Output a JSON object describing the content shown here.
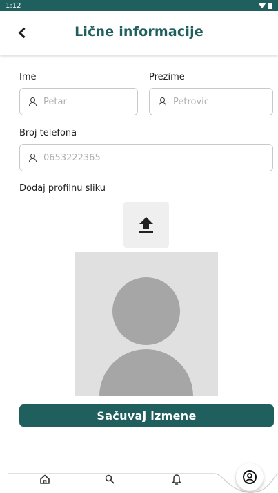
{
  "status_bar": {
    "time": "1:12"
  },
  "header": {
    "title": "Lične informacije"
  },
  "form": {
    "first_name": {
      "label": "Ime",
      "placeholder": "Petar"
    },
    "last_name": {
      "label": "Prezime",
      "placeholder": "Petrovic"
    },
    "phone": {
      "label": "Broj telefona",
      "placeholder": "0653222365"
    },
    "photo": {
      "label": "Dodaj profilnu sliku"
    }
  },
  "actions": {
    "save_label": "Sačuvaj izmene"
  },
  "bottom_nav": {
    "items": [
      {
        "icon": "home-icon"
      },
      {
        "icon": "search-icon"
      },
      {
        "icon": "bell-icon"
      },
      {
        "icon": "profile-icon"
      }
    ]
  },
  "colors": {
    "brand": "#1f5f5e",
    "field_border": "#c9c9c9",
    "placeholder": "#b0b0b0"
  }
}
